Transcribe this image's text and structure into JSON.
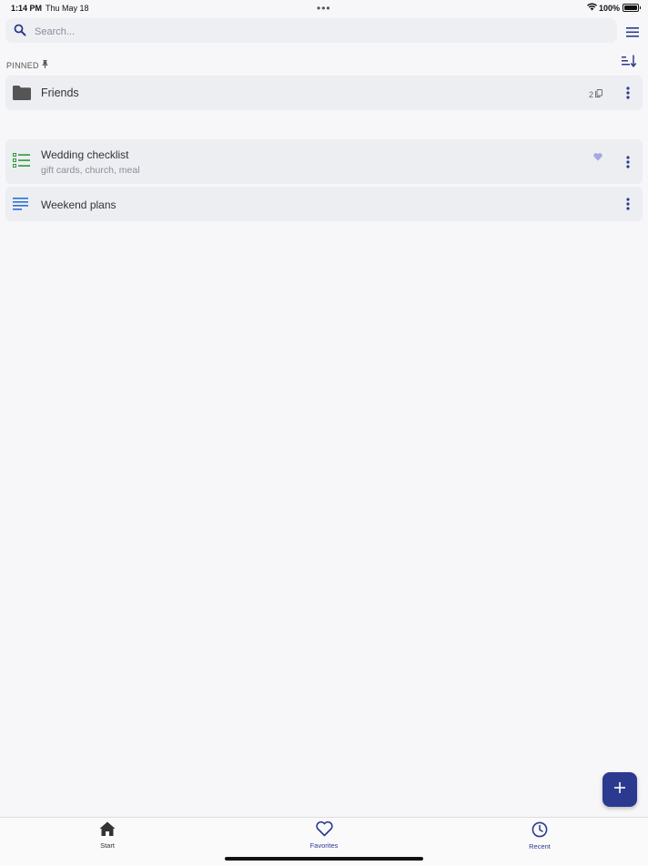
{
  "status_bar": {
    "time": "1:14 PM",
    "date": "Thu May 18",
    "battery": "100%",
    "battery_level": 1.0
  },
  "search": {
    "placeholder": "Search..."
  },
  "sections": {
    "pinned_label": "PINNED"
  },
  "items": {
    "folder": {
      "title": "Friends",
      "count": "2",
      "icon": "folder-icon"
    },
    "checklist": {
      "title": "Wedding checklist",
      "subtitle": "gift cards, church, meal",
      "icon": "checklist-icon",
      "favorite": true
    },
    "note": {
      "title": "Weekend plans",
      "icon": "note-lines-icon"
    }
  },
  "tabs": {
    "start": "Start",
    "favorites": "Favorites",
    "recent": "Recent"
  },
  "colors": {
    "accent": "#2b3a8f",
    "checklist_green": "#2e9a3a",
    "note_blue": "#2b6fd6",
    "favorite_heart": "#a5a9e0"
  }
}
